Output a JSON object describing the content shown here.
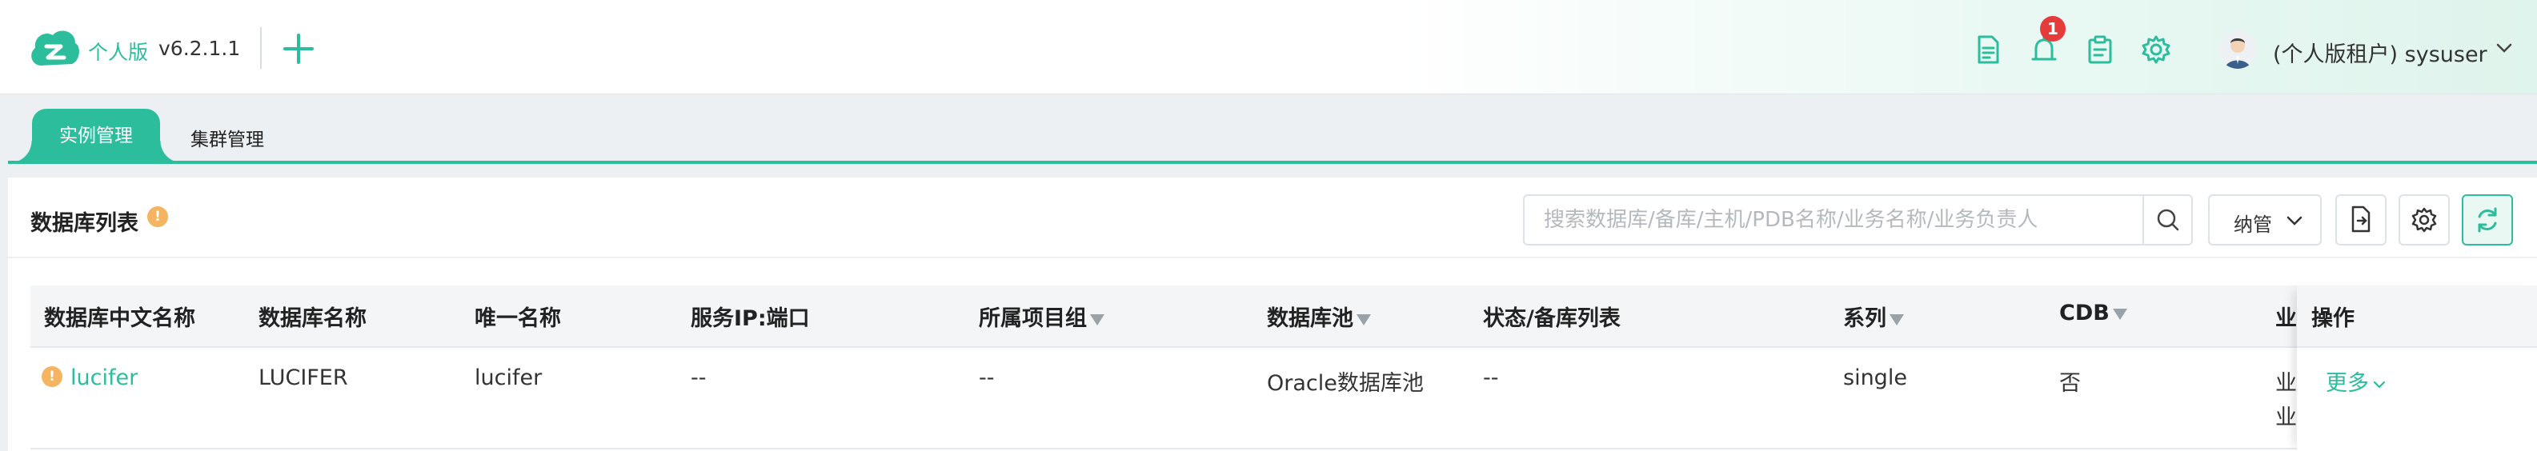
{
  "header": {
    "brand": "个人版",
    "version": "v6.2.1.1",
    "notification_count": "1",
    "user_label": "(个人版租户) sysuser",
    "accent_color": "#2bbd9c",
    "icons": [
      "document-icon",
      "bell-icon",
      "clipboard-icon",
      "gear-icon"
    ]
  },
  "tabs": [
    {
      "label": "实例管理",
      "active": true
    },
    {
      "label": "集群管理",
      "active": false
    }
  ],
  "panel": {
    "title": "数据库列表",
    "info_badge": "!",
    "search_placeholder": "搜索数据库/备库/主机/PDB名称/业务名称/业务负责人",
    "manage_label": "纳管"
  },
  "table": {
    "columns": [
      "数据库中文名称",
      "数据库名称",
      "唯一名称",
      "服务IP:端口",
      "所属项目组",
      "数据库池",
      "状态/备库列表",
      "系列",
      "CDB",
      "业",
      "操作"
    ],
    "rows": [
      {
        "cn_name": "lucifer",
        "db_name": "LUCIFER",
        "unique_name": "lucifer",
        "service_ip": "--",
        "project_group": "--",
        "pool": "Oracle数据库池",
        "status": "--",
        "series": "single",
        "cdb": "否",
        "biz_1": "业",
        "biz_2": "业",
        "more": "更多"
      }
    ]
  }
}
